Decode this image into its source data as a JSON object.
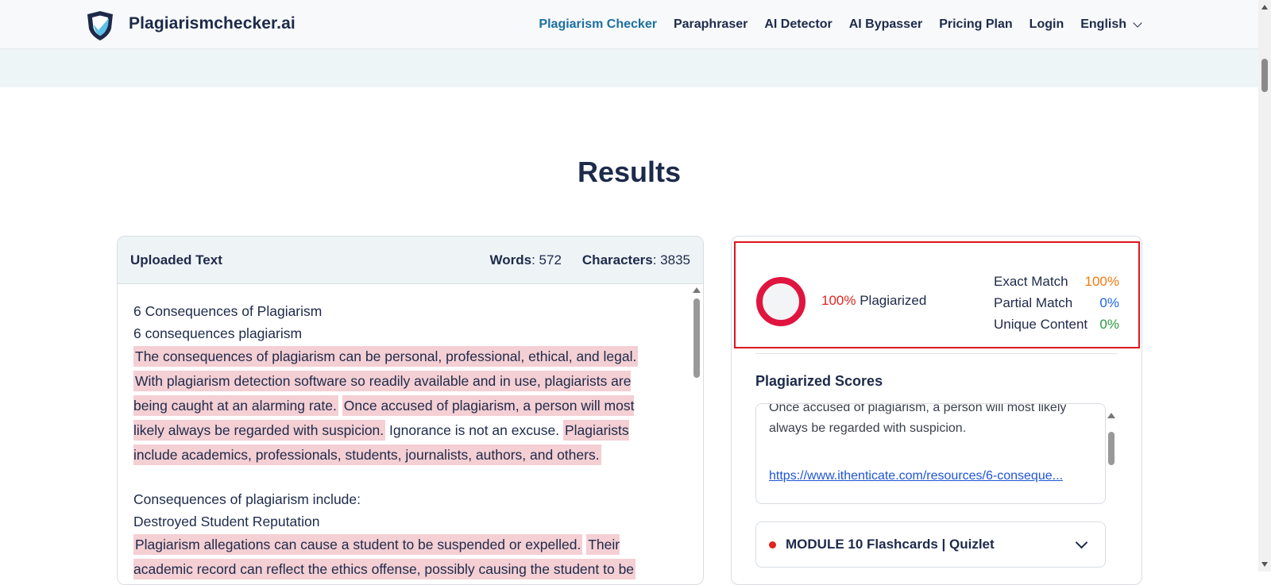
{
  "header": {
    "brand": "Plagiarismchecker.ai",
    "nav": [
      {
        "label": "Plagiarism Checker"
      },
      {
        "label": "Paraphraser"
      },
      {
        "label": "AI Detector"
      },
      {
        "label": "AI Bypasser"
      },
      {
        "label": "Pricing Plan"
      },
      {
        "label": "Login"
      }
    ],
    "language": "English",
    "colors": {
      "brand_dark": "#1d2a4a",
      "active_nav": "#1b6fa1",
      "shield_light": "#5cc2e6"
    }
  },
  "page_title": "Results",
  "uploaded": {
    "heading": "Uploaded Text",
    "words_label": "Words",
    "words_value": ": 572",
    "chars_label": "Characters",
    "chars_value": ": 3835",
    "title1": "6 Consequences of Plagiarism",
    "title2": "6 consequences plagiarism",
    "p1_h1": "The consequences of plagiarism can be personal, professional, ethical, and legal.",
    "p1_h2": "With plagiarism detection software so readily available and in use, plagiarists are being caught at an alarming rate.",
    "p1_h3": "Once accused of plagiarism, a person will most likely always be regarded with suspicion.",
    "p1_plain": "Ignorance is not an excuse.",
    "p1_h4": "Plagiarists include academics, professionals, students, journalists, authors, and others.",
    "list_intro": "Consequences of plagiarism include:",
    "sub_heading": "Destroyed Student Reputation",
    "p2_h1": "Plagiarism allegations can cause a student to be suspended or expelled.",
    "p2_h2": "Their academic record can reflect the ethics offense, possibly causing the student to be",
    "highlight_color": "#f4cfd3"
  },
  "results": {
    "plag_pct": "100%",
    "plag_label": "Plagiarized",
    "exact_label": "Exact Match",
    "exact_value": "100%",
    "partial_label": "Partial Match",
    "partial_value": "0%",
    "unique_label": "Unique Content",
    "unique_value": "0%",
    "plagiarized_fraction": 1.0,
    "colors": {
      "ring": "#e0153f",
      "exact": "#f07a10",
      "partial": "#1f66e5",
      "unique": "#2b9a3c",
      "box": "#e0141f"
    }
  },
  "scores": {
    "heading": "Plagiarized Scores",
    "snippet": "Once accused of plagiarism, a person will most likely always be regarded with suspicion.",
    "link": "https://www.ithenticate.com/resources/6-conseque...",
    "module": "MODULE 10 Flashcards | Quizlet"
  }
}
